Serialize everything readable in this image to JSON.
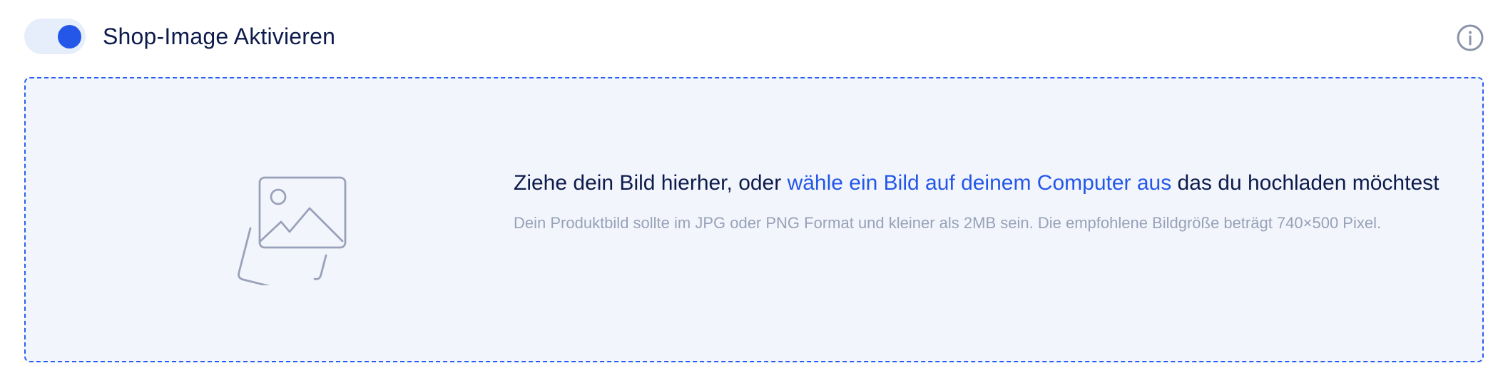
{
  "toggle": {
    "label": "Shop-Image Aktivieren",
    "state": "on",
    "accent_color": "#2457e8"
  },
  "info": {
    "icon": "info-icon"
  },
  "dropzone": {
    "icon": "image-placeholder-icon",
    "text_before": "Ziehe dein Bild hierher, oder ",
    "link_text": "wähle ein Bild auf deinem Computer aus",
    "text_after": " das du hochladen möchtest",
    "hint": "Dein Produktbild sollte im JPG oder PNG Format und kleiner als 2MB sein. Die empfohlene Bildgröße beträgt 740×500 Pixel.",
    "border_color": "#2a5ef0",
    "background_color": "#f2f6fc"
  }
}
